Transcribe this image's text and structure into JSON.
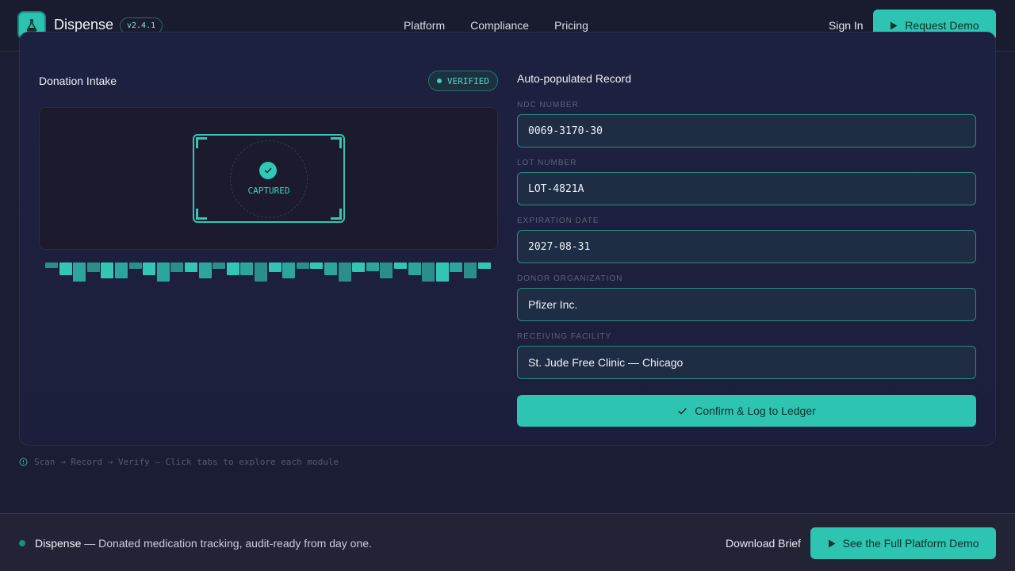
{
  "header": {
    "brand": "Dispense",
    "version": "v2.4.1",
    "nav": [
      "Platform",
      "Compliance",
      "Pricing"
    ],
    "sign_in": "Sign In",
    "cta": "Request Demo"
  },
  "intake": {
    "title": "Donation Intake",
    "status": "VERIFIED",
    "scan_state": "CAPTURED"
  },
  "record": {
    "title": "Auto-populated Record",
    "fields": [
      {
        "label": "NDC NUMBER",
        "value": "0069-3170-30"
      },
      {
        "label": "LOT NUMBER",
        "value": "LOT-4821A"
      },
      {
        "label": "EXPIRATION DATE",
        "value": "2027-08-31"
      },
      {
        "label": "DONOR ORGANIZATION",
        "value": "Pfizer Inc."
      },
      {
        "label": "RECEIVING FACILITY",
        "value": "St. Jude Free Clinic — Chicago"
      }
    ],
    "confirm": "Confirm & Log to Ledger"
  },
  "hint": "Scan → Record → Verify — Click tabs to explore each module",
  "footer": {
    "brand": "Dispense",
    "tagline": " — Donated medication tracking, audit-ready from day one.",
    "download": "Download Brief",
    "cta": "See the Full Platform Demo"
  },
  "colors": {
    "accent": "#2ec4b2",
    "background": "#1b1d34"
  }
}
